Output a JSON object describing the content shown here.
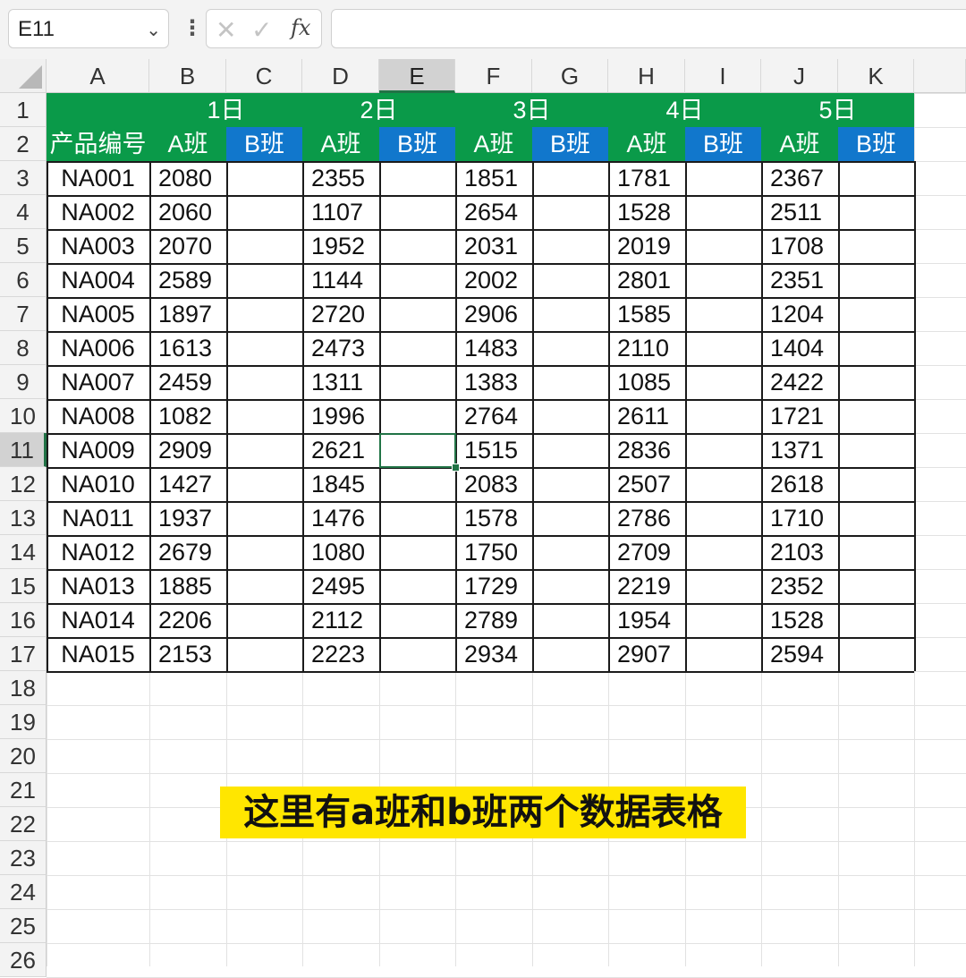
{
  "formula_bar": {
    "name_box": "E11",
    "name_box_arrow": "⌄",
    "separator": "⋮",
    "cancel_icon": "✕",
    "enter_icon": "✓",
    "fx_label": "fx",
    "formula": ""
  },
  "columns": [
    "A",
    "B",
    "C",
    "D",
    "E",
    "F",
    "G",
    "H",
    "I",
    "J",
    "K"
  ],
  "active_column": "E",
  "rows": [
    "1",
    "2",
    "3",
    "4",
    "5",
    "6",
    "7",
    "8",
    "9",
    "10",
    "11",
    "12",
    "13",
    "14",
    "15",
    "16",
    "17",
    "18",
    "19",
    "20",
    "21",
    "22",
    "23",
    "24",
    "25",
    "26"
  ],
  "active_row": "11",
  "header_row1": {
    "A": "",
    "days": [
      "1日",
      "2日",
      "3日",
      "4日",
      "5日"
    ]
  },
  "header_row2": {
    "product_code": "产品编号",
    "shift_a": "A班",
    "shift_b": "B班"
  },
  "table": [
    {
      "code": "NA001",
      "values": [
        2080,
        2355,
        1851,
        1781,
        2367
      ]
    },
    {
      "code": "NA002",
      "values": [
        2060,
        1107,
        2654,
        1528,
        2511
      ]
    },
    {
      "code": "NA003",
      "values": [
        2070,
        1952,
        2031,
        2019,
        1708
      ]
    },
    {
      "code": "NA004",
      "values": [
        2589,
        1144,
        2002,
        2801,
        2351
      ]
    },
    {
      "code": "NA005",
      "values": [
        1897,
        2720,
        2906,
        1585,
        1204
      ]
    },
    {
      "code": "NA006",
      "values": [
        1613,
        2473,
        1483,
        2110,
        1404
      ]
    },
    {
      "code": "NA007",
      "values": [
        2459,
        1311,
        1383,
        1085,
        2422
      ]
    },
    {
      "code": "NA008",
      "values": [
        1082,
        1996,
        2764,
        2611,
        1721
      ]
    },
    {
      "code": "NA009",
      "values": [
        2909,
        2621,
        1515,
        2836,
        1371
      ]
    },
    {
      "code": "NA010",
      "values": [
        1427,
        1845,
        2083,
        2507,
        2618
      ]
    },
    {
      "code": "NA011",
      "values": [
        1937,
        1476,
        1578,
        2786,
        1710
      ]
    },
    {
      "code": "NA012",
      "values": [
        2679,
        1080,
        1750,
        2709,
        2103
      ]
    },
    {
      "code": "NA013",
      "values": [
        1885,
        2495,
        1729,
        2219,
        2352
      ]
    },
    {
      "code": "NA014",
      "values": [
        2206,
        2112,
        2789,
        1954,
        1528
      ]
    },
    {
      "code": "NA015",
      "values": [
        2153,
        2223,
        2934,
        2907,
        2594
      ]
    }
  ],
  "caption": "这里有a班和b班两个数据表格",
  "colors": {
    "header_green": "#0a9a49",
    "header_blue": "#1177cc",
    "selection": "#217346",
    "caption_bg": "#ffe600"
  }
}
